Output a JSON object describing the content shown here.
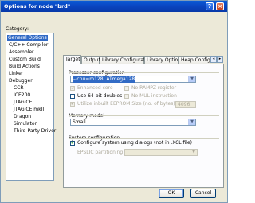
{
  "window": {
    "title": "Options for node \"brd\""
  },
  "titlebar_buttons": {
    "help": "?",
    "close": "×"
  },
  "category": {
    "label": "Category:",
    "items": [
      "General Options",
      "C/C++ Compiler",
      "Assembler",
      "Custom Build",
      "Build Actions",
      "Linker",
      "Debugger",
      "CCR",
      "ICE200",
      "JTAGICE",
      "JTAGICE mkII",
      "Dragon",
      "Simulator",
      "Third-Party Driver"
    ]
  },
  "tabs": [
    "Target",
    "Output",
    "Library Configuration",
    "Library Options",
    "Heap Configu"
  ],
  "processor": {
    "group_label": "Processor configuration",
    "value": "--cpu=m128,    ATmega128",
    "enhanced_core": "Enhanced core",
    "no_rampz": "No RAMPZ register",
    "use_64bit": "Use 64-bit doubles",
    "no_mul": "No MUL instruction",
    "utilize_inbuilt": "Utilize inbuilt EEPROM  Size (no. of bytes):",
    "eeprom_size": "4096"
  },
  "memory": {
    "group_label": "Memory model",
    "value": "Small"
  },
  "system": {
    "group_label": "System configuration",
    "configure_label": "Configure system using dialogs (not in .XCL file)",
    "eps_label": "EPSLIC partitioning"
  },
  "buttons": {
    "ok": "OK",
    "cancel": "Cancel"
  },
  "colors": {
    "titlebar": "#0a48c4",
    "selection": "#316ac5",
    "dialog_bg": "#ece9d8"
  }
}
